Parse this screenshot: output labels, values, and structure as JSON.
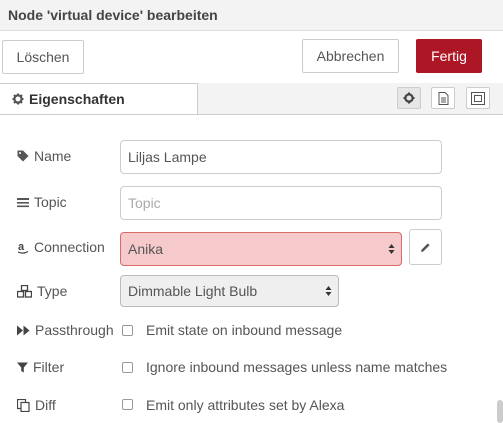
{
  "window": {
    "title": "Node 'virtual device' bearbeiten"
  },
  "toolbar": {
    "delete_label": "Löschen",
    "cancel_label": "Abbrechen",
    "done_label": "Fertig"
  },
  "tabs": {
    "properties_label": "Eigenschaften"
  },
  "form": {
    "name": {
      "label": "Name",
      "value": "Liljas Lampe"
    },
    "topic": {
      "label": "Topic",
      "placeholder": "Topic",
      "value": ""
    },
    "connection": {
      "label": "Connection",
      "value": "Anika"
    },
    "type": {
      "label": "Type",
      "value": "Dimmable Light Bulb"
    },
    "passthrough": {
      "label": "Passthrough",
      "checkbox_text": "Emit state on inbound message",
      "checked": false
    },
    "filter": {
      "label": "Filter",
      "checkbox_text": "Ignore inbound messages unless name matches",
      "checked": false
    },
    "diff": {
      "label": "Diff",
      "checkbox_text": "Emit only attributes set by Alexa",
      "checked": false
    }
  },
  "colors": {
    "primary": "#ad1625",
    "error_bg": "#f6caca",
    "error_border": "#d96a6a"
  }
}
